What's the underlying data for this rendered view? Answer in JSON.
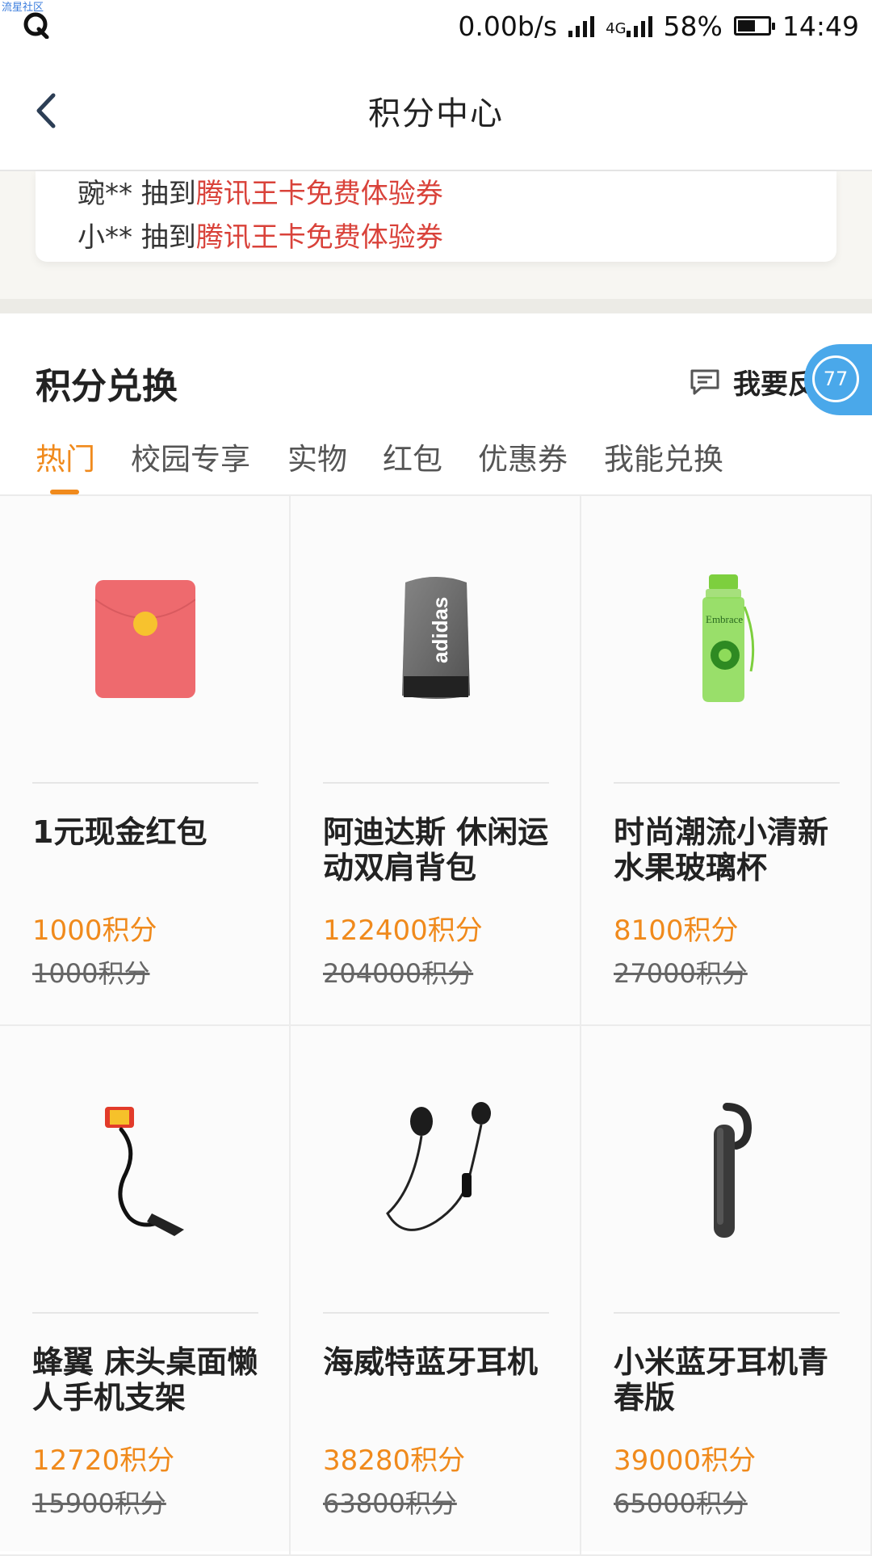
{
  "status_bar": {
    "watermark": "流星社区",
    "speed": "0.00b/s",
    "network": "4G",
    "battery": "58%",
    "battery_level": 0.58,
    "time": "14:49"
  },
  "header": {
    "title": "积分中心",
    "back_icon": "chevron-left-icon"
  },
  "ticker": [
    {
      "user": "豌** 抽到",
      "prize": "腾讯王卡免费体验券"
    },
    {
      "user": "小** 抽到",
      "prize": "腾讯王卡免费体验券"
    }
  ],
  "section": {
    "title": "积分兑换",
    "feedback_label": "我要反馈",
    "feedback_icon": "chat-icon",
    "float_badge": "77"
  },
  "tabs": [
    {
      "label": "热门",
      "active": true
    },
    {
      "label": "校园专享"
    },
    {
      "label": "实物"
    },
    {
      "label": "红包"
    },
    {
      "label": "优惠券"
    },
    {
      "label": "我能兑换"
    }
  ],
  "items": [
    {
      "name": "1元现金红包",
      "price": "1000积分",
      "original": "1000积分",
      "icon": "red-envelope-icon"
    },
    {
      "name": "阿迪达斯 休闲运动双肩背包",
      "price": "122400积分",
      "original": "204000积分",
      "icon": "backpack-icon",
      "brand_text": "adidas"
    },
    {
      "name": "时尚潮流小清新水果玻璃杯",
      "price": "8100积分",
      "original": "27000积分",
      "icon": "water-bottle-icon",
      "brand_text": "Embrace"
    },
    {
      "name": "蜂翼 床头桌面懒人手机支架",
      "price": "12720积分",
      "original": "15900积分",
      "icon": "phone-holder-icon"
    },
    {
      "name": "海威特蓝牙耳机",
      "price": "38280积分",
      "original": "63800积分",
      "icon": "earphones-icon"
    },
    {
      "name": "小米蓝牙耳机青春版",
      "price": "39000积分",
      "original": "65000积分",
      "icon": "bluetooth-headset-icon"
    }
  ],
  "colors": {
    "accent": "#f08a1c",
    "highlight": "#d9423a",
    "badge": "#4aa8ea"
  }
}
